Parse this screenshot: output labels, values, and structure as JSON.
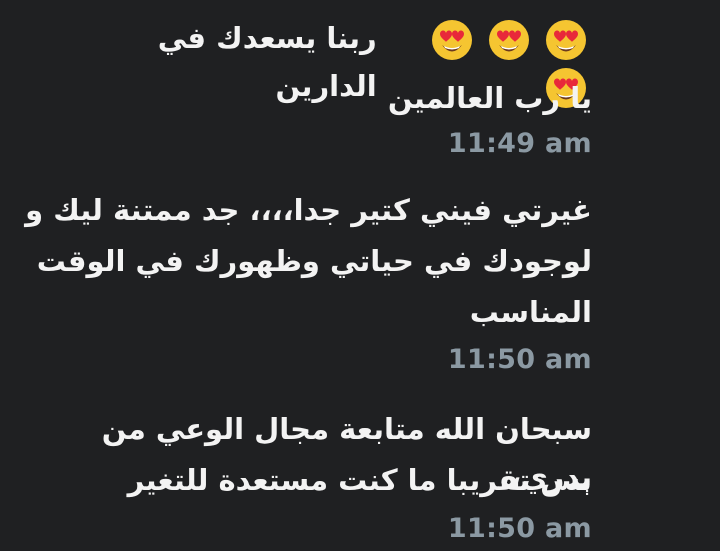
{
  "messages": [
    {
      "line1_text": "ربنا يسعدك في الدارين",
      "line2_text": "يا رب العالمين",
      "emoji": [
        "heart-eyes",
        "heart-eyes",
        "heart-eyes",
        "heart-eyes"
      ],
      "time": "11:49 am"
    },
    {
      "line1_text": "غيرتي فيني كتير جدا،،،، جد ممتنة ليك و",
      "line2_text": "لوجودك في حياتي وظهورك في الوقت",
      "line3_text": "المناسب",
      "time": "11:50 am"
    },
    {
      "line1_text": "سبحان الله متابعة مجال الوعي من بدري،،",
      "line2_text": "بس تقريبا ما كنت مستعدة للتغير",
      "time": "11:50 am"
    }
  ],
  "colors": {
    "background": "#1f2022",
    "text": "#f3f3f3",
    "timestamp": "#8b99a3"
  }
}
